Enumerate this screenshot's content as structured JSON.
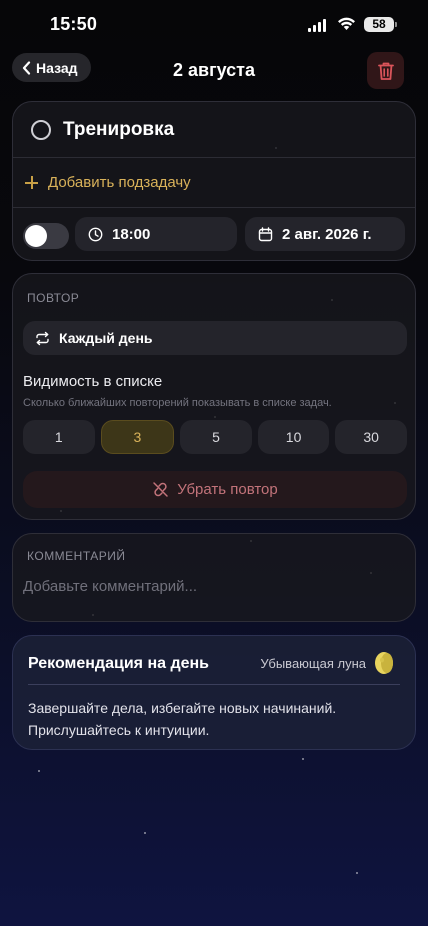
{
  "status_bar": {
    "time": "15:50",
    "battery": "58"
  },
  "nav": {
    "back_label": "Назад",
    "title": "2 августа"
  },
  "task": {
    "title": "Тренировка",
    "add_subtask_label": "Добавить подзадачу",
    "reminder_enabled": false,
    "time": "18:00",
    "date": "2 авг. 2026 г."
  },
  "repeat": {
    "section_label": "ПОВТОР",
    "mode": "Каждый день",
    "visibility_title": "Видимость в списке",
    "visibility_hint": "Сколько ближайших повторений показывать в списке задач.",
    "options": [
      "1",
      "3",
      "5",
      "10",
      "30"
    ],
    "selected": "3",
    "remove_label": "Убрать повтор"
  },
  "comment": {
    "section_label": "КОММЕНТАРИЙ",
    "placeholder": "Добавьте комментарий...",
    "value": ""
  },
  "recommendation": {
    "title": "Рекомендация на день",
    "moon_phase": "Убывающая луна",
    "text": "Завершайте дела, избегайте новых начинаний. Прислушайтесь к интуиции."
  },
  "colors": {
    "accent": "#d9b25a",
    "danger": "#c2737a",
    "background": "#08080d"
  },
  "icons": [
    "chevron-left-icon",
    "trash-icon",
    "clock-icon",
    "calendar-icon",
    "repeat-icon",
    "link-off-icon",
    "moon-icon"
  ]
}
